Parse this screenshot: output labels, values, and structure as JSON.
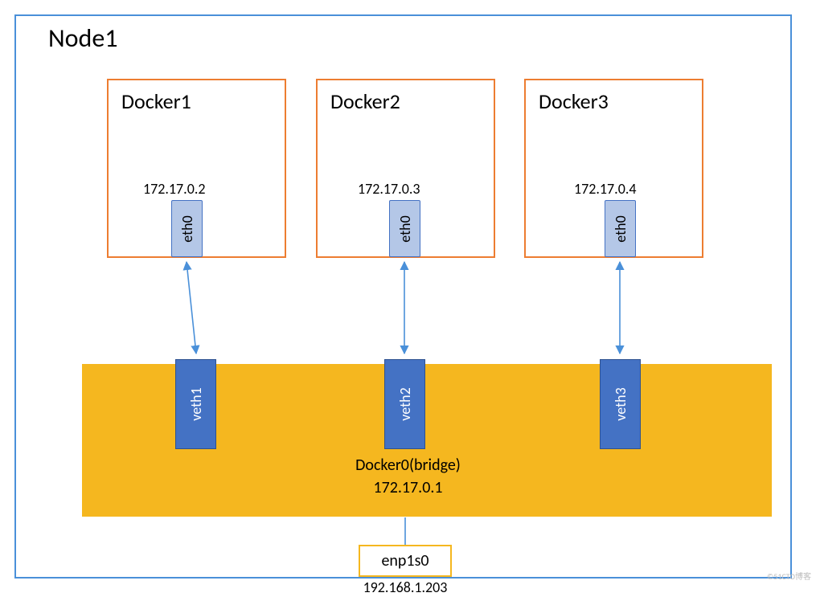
{
  "node_title": "Node1",
  "dockers": [
    {
      "title": "Docker1",
      "ip": "172.17.0.2",
      "eth_label": "eth0"
    },
    {
      "title": "Docker2",
      "ip": "172.17.0.3",
      "eth_label": "eth0"
    },
    {
      "title": "Docker3",
      "ip": "172.17.0.4",
      "eth_label": "eth0"
    }
  ],
  "veths": [
    "veth1",
    "veth2",
    "veth3"
  ],
  "bridge": {
    "name": "Docker0(bridge)",
    "ip": "172.17.0.1"
  },
  "host_if": {
    "name": "enp1s0",
    "ip": "192.168.1.203"
  },
  "watermark": "©51CTO博客"
}
